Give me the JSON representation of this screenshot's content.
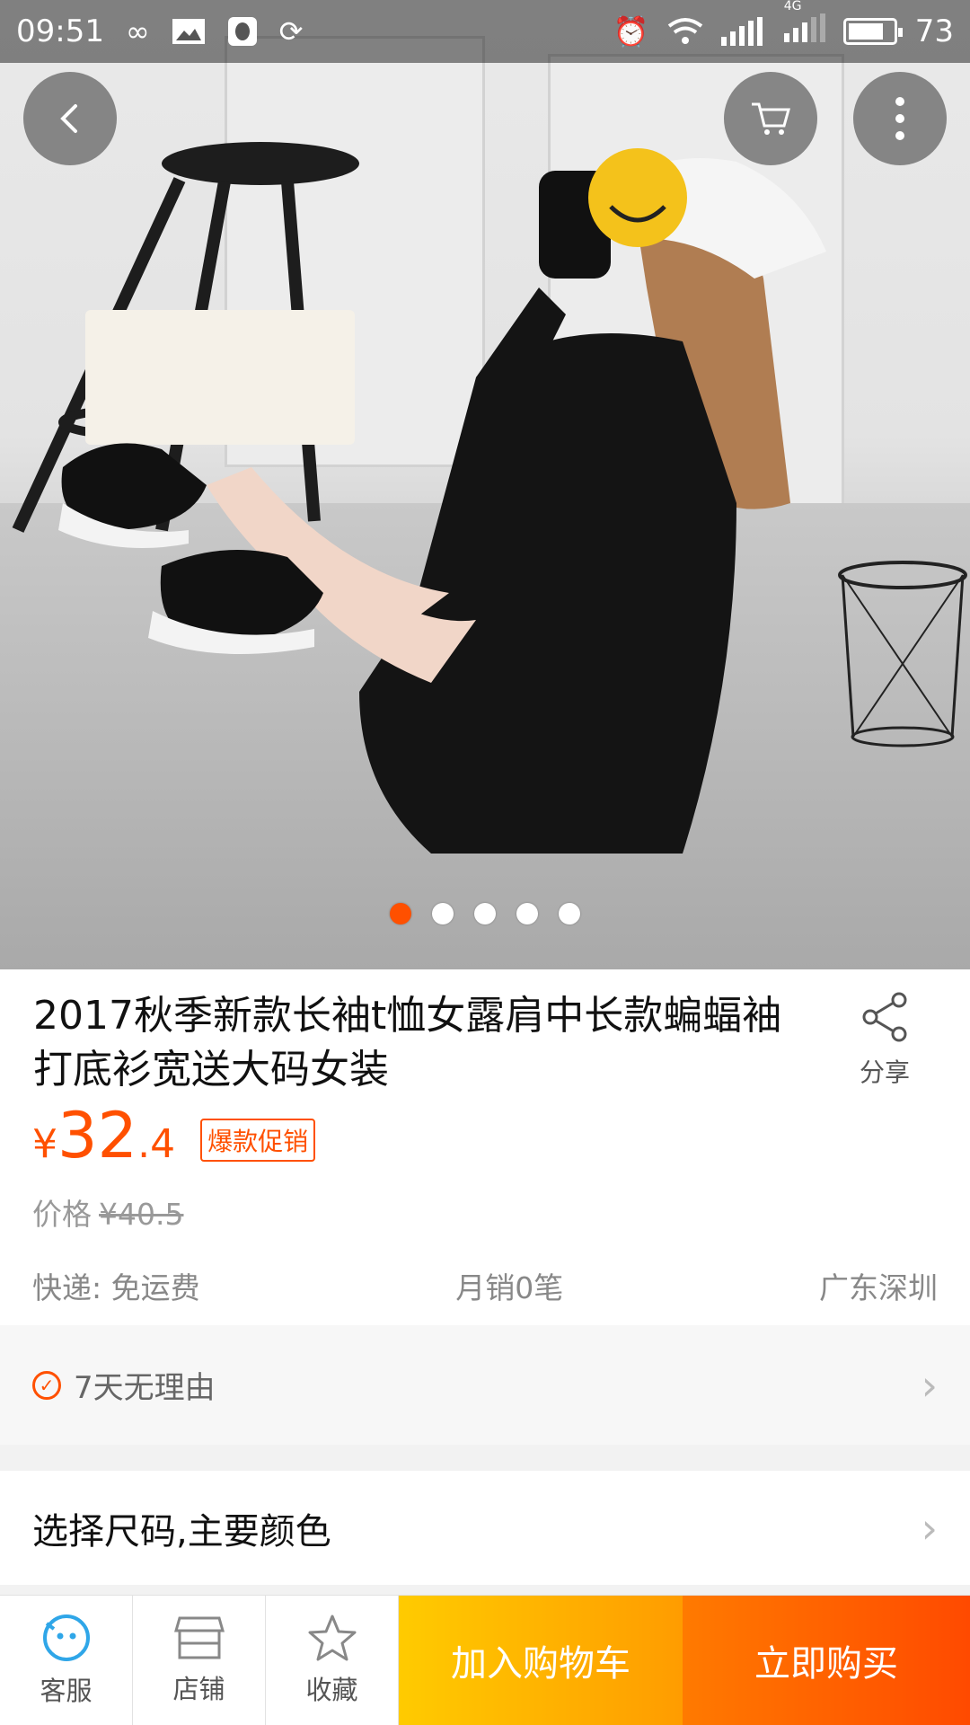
{
  "status_bar": {
    "time": "09:51",
    "network": "4G",
    "battery_level": "73",
    "icons": [
      "infinity-icon",
      "image-icon",
      "qq-icon",
      "sync-icon",
      "alarm-icon",
      "wifi-icon",
      "signal-icon",
      "signal-4g-icon",
      "battery-icon"
    ]
  },
  "gallery": {
    "image_count": 5,
    "active_index": 0
  },
  "overlay": {
    "back_icon": "back-arrow-icon",
    "cart_icon": "cart-icon",
    "more_icon": "more-vertical-icon"
  },
  "product": {
    "title": "2017秋季新款长袖t恤女露肩中长款蝙蝠袖打底衫宽送大码女装",
    "share_label": "分享",
    "price_symbol": "¥",
    "price_integer": "32",
    "price_decimal": ".4",
    "promo_badge": "爆款促销",
    "original_price_label": "价格",
    "original_price": "¥40.5",
    "shipping": "快递: 免运费",
    "monthly_sales": "月销0笔",
    "location": "广东深圳"
  },
  "guarantee": {
    "text": "7天无理由"
  },
  "options": {
    "select_text": "选择尺码,主要颜色"
  },
  "bottom_bar": {
    "service_label": "客服",
    "shop_label": "店铺",
    "favorite_label": "收藏",
    "add_to_cart_label": "加入购物车",
    "buy_now_label": "立即购买"
  },
  "colors": {
    "accent": "#ff5000",
    "cart_button": "#ffb400",
    "buy_button": "#ff5a00",
    "service_icon": "#2fa6e8"
  }
}
